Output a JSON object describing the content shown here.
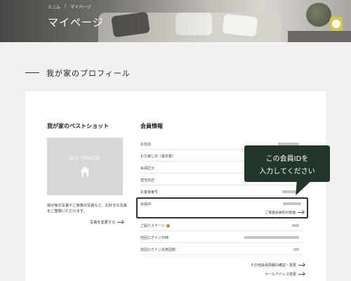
{
  "breadcrumb": [
    "ミニム",
    "/",
    "マイページ"
  ],
  "page_title": "マイページ",
  "section_title": "我が家のプロフィール",
  "photo": {
    "heading": "我が家のベストショット",
    "placeholder": "NO IMAGE",
    "description": "我が家の写真やご家族の写真など、お好きな写真をご登録いただけます。",
    "change_label": "写真を変更する"
  },
  "member": {
    "heading": "会員情報",
    "rows": [
      {
        "label": "お名前"
      },
      {
        "label": "お引渡し日（築年数）"
      },
      {
        "label": "会員区分"
      },
      {
        "label": "担当支店"
      },
      {
        "label": "お客様番号"
      }
    ],
    "id_row": {
      "label": "会員ID",
      "link": "ご家族会員IDの管理"
    },
    "rows2": [
      {
        "label": "ご紹介ステージ"
      },
      {
        "label": "前回ログイン日時"
      },
      {
        "label": "前回ログイン失敗回数"
      }
    ],
    "other_link": "その他会員情報の確認・変更",
    "email_link": "メールアドレス変更"
  },
  "callout": {
    "line1": "この会員IDを",
    "line2": "入力してください"
  }
}
